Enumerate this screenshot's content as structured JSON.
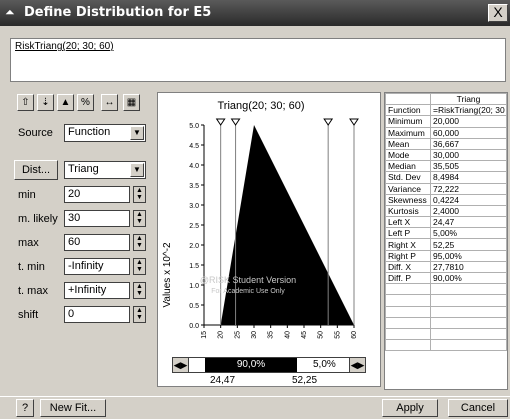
{
  "window": {
    "title": "Define Distribution for E5",
    "close_label": "X"
  },
  "formula": "RiskTriang(20; 30; 60)",
  "toolbar": {
    "buttons": [
      {
        "name": "copy-distribution-button",
        "icon": "⇧"
      },
      {
        "name": "paste-distribution-button",
        "icon": "⇣"
      },
      {
        "name": "graph-type-button",
        "icon": "▲"
      },
      {
        "name": "statistics-button",
        "icon": "%"
      },
      {
        "name": "delimiters-button",
        "icon": "↔"
      },
      {
        "name": "table-button",
        "icon": "▦"
      }
    ]
  },
  "form": {
    "source_label": "Source",
    "source_value": "Function",
    "dist_button": "Dist...",
    "dist_value": "Triang",
    "params": [
      {
        "label": "min",
        "value": "20"
      },
      {
        "label": "m. likely",
        "value": "30"
      },
      {
        "label": "max",
        "value": "60"
      },
      {
        "label": "t. min",
        "value": "-Infinity"
      },
      {
        "label": "t. max",
        "value": "+Infinity"
      },
      {
        "label": "shift",
        "value": "0"
      }
    ]
  },
  "chart_data": {
    "type": "area",
    "title": "Triang(20; 30; 60)",
    "ylabel": "Values x 10^-2",
    "x": [
      20,
      30,
      60
    ],
    "y": [
      0,
      5.0,
      0
    ],
    "xlim": [
      15,
      60
    ],
    "ylim": [
      0,
      5.0
    ],
    "xticks": [
      "15",
      "20",
      "25",
      "30",
      "35",
      "40",
      "45",
      "50",
      "55",
      "60"
    ],
    "yticks": [
      "0.0",
      "0.5",
      "1.0",
      "1.5",
      "2.0",
      "2.5",
      "3.0",
      "3.5",
      "4.0",
      "4.5",
      "5.0"
    ],
    "watermark_line1": "@RISK Student Version",
    "watermark_line2": "For Academic Use Only",
    "delimiters": {
      "left_x": "24,47",
      "right_x": "52,25",
      "left_pct": "",
      "middle_pct": "90,0%",
      "right_pct": "5,0%"
    }
  },
  "stats": {
    "header": "Triang",
    "rows": [
      {
        "label": "Function",
        "value": "=RiskTriang(20; 30"
      },
      {
        "label": "Minimum",
        "value": "20,000"
      },
      {
        "label": "Maximum",
        "value": "60,000"
      },
      {
        "label": "Mean",
        "value": "36,667"
      },
      {
        "label": "Mode",
        "value": "30,000"
      },
      {
        "label": "Median",
        "value": "35,505"
      },
      {
        "label": "Std. Dev",
        "value": "8,4984"
      },
      {
        "label": "Variance",
        "value": "72,222"
      },
      {
        "label": "Skewness",
        "value": "0,4224"
      },
      {
        "label": "Kurtosis",
        "value": "2,4000"
      },
      {
        "label": "Left X",
        "value": "24,47"
      },
      {
        "label": "Left P",
        "value": "5,00%"
      },
      {
        "label": "Right X",
        "value": "52,25"
      },
      {
        "label": "Right P",
        "value": "95,00%"
      },
      {
        "label": "Diff. X",
        "value": "27,7810"
      },
      {
        "label": "Diff. P",
        "value": "90,00%"
      }
    ]
  },
  "footer": {
    "help_icon": "?",
    "new_fit": "New Fit...",
    "apply": "Apply",
    "cancel": "Cancel"
  }
}
